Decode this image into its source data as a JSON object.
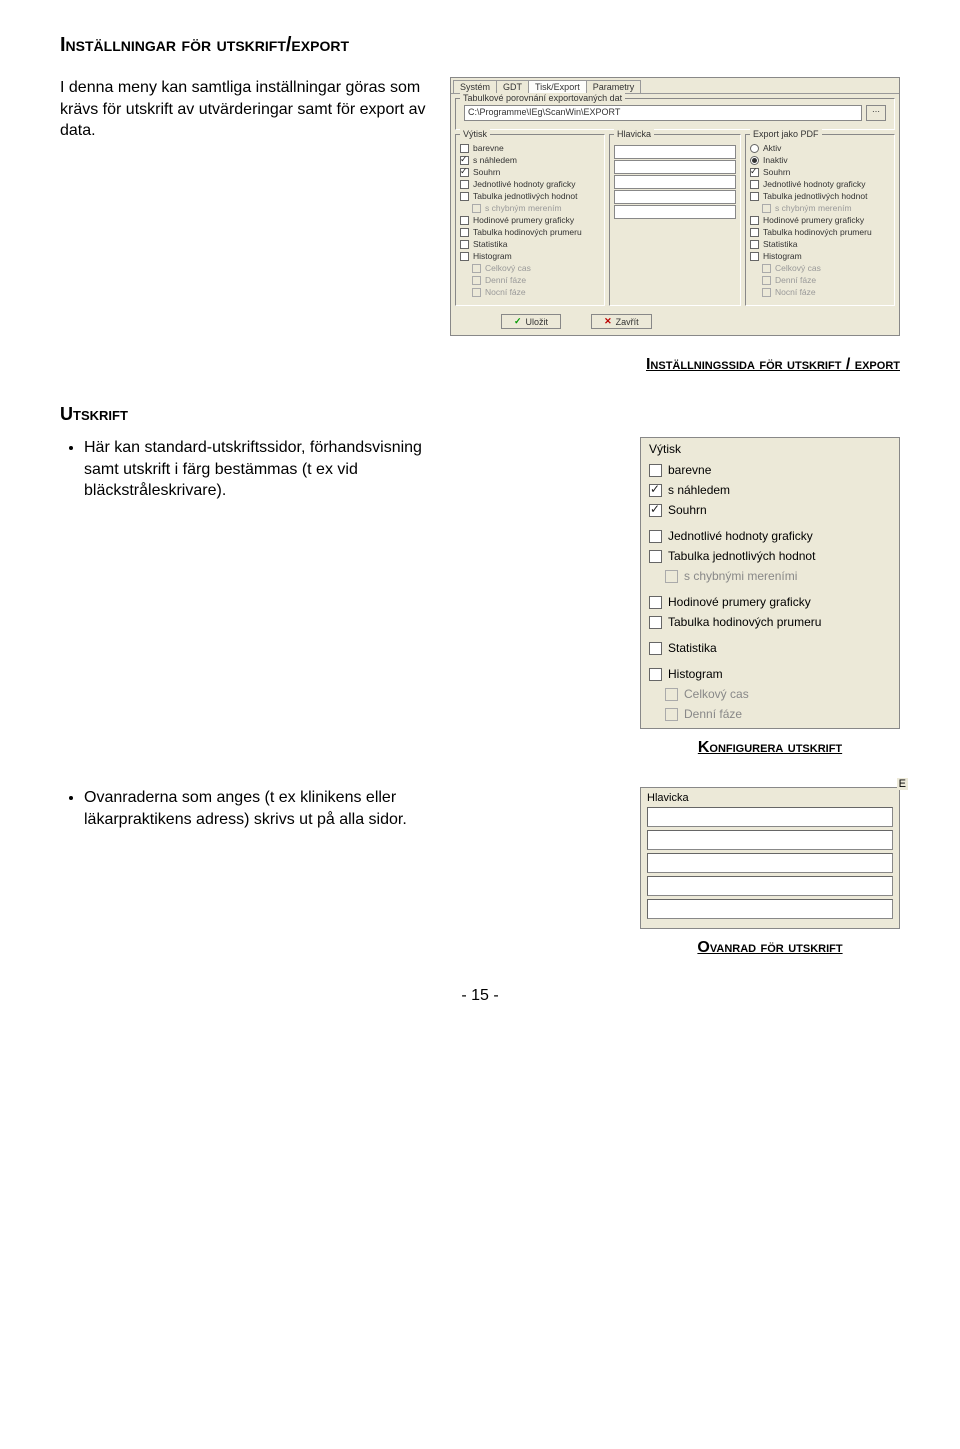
{
  "headings": {
    "main": "Inställningar för utskrift/export",
    "caption1": "Inställningssida för utskrift / export",
    "sub_utskrift": "Utskrift",
    "caption2": "Konfigurera utskrift",
    "caption3": "Ovanrad för utskrift"
  },
  "intro": "I denna meny kan samtliga inställningar göras som krävs för utskrift av utvärderingar samt för export av data.",
  "bullet1": "Här kan standard-utskriftssidor, förhandsvisning samt utskrift i färg bestämmas (t ex vid bläckstråleskrivare).",
  "bullet2": "Ovanraderna som anges (t ex klinikens eller läkarpraktikens adress) skrivs ut på alla sidor.",
  "settings_window": {
    "tabs": [
      "Systém",
      "GDT",
      "Tisk/Export",
      "Parametry"
    ],
    "group_label": "Tabulkové porovnání exportovaných dat",
    "path": "C:\\Programme\\IEg\\ScanWin\\EXPORT",
    "col_vytisk": {
      "title": "Výtisk",
      "items": [
        {
          "label": "barevne",
          "checked": false
        },
        {
          "label": "s náhledem",
          "checked": true
        },
        {
          "label": "Souhrn",
          "checked": true
        },
        {
          "label": "Jednotlivé hodnoty graficky",
          "checked": false
        },
        {
          "label": "Tabulka jednotlivých hodnot",
          "checked": false
        },
        {
          "label": "s chybným merením",
          "checked": false,
          "indent": true,
          "disabled": true
        },
        {
          "label": "Hodinové prumery graficky",
          "checked": false
        },
        {
          "label": "Tabulka hodinových prumeru",
          "checked": false
        },
        {
          "label": "Statistika",
          "checked": false
        },
        {
          "label": "Histogram",
          "checked": false
        },
        {
          "label": "Celkový cas",
          "checked": false,
          "indent": true,
          "disabled": true
        },
        {
          "label": "Denní fáze",
          "checked": false,
          "indent": true,
          "disabled": true
        },
        {
          "label": "Nocní fáze",
          "checked": false,
          "indent": true,
          "disabled": true
        }
      ]
    },
    "col_hlavicka": {
      "title": "Hlavicka"
    },
    "col_export": {
      "title": "Export jako PDF",
      "radios": [
        {
          "label": "Aktiv",
          "checked": false
        },
        {
          "label": "Inaktiv",
          "checked": true
        }
      ],
      "items": [
        {
          "label": "Souhrn",
          "checked": true
        },
        {
          "label": "Jednotlivé hodnoty graficky",
          "checked": false
        },
        {
          "label": "Tabulka jednotlivých hodnot",
          "checked": false
        },
        {
          "label": "s chybným merením",
          "checked": false,
          "indent": true,
          "disabled": true
        },
        {
          "label": "Hodinové prumery graficky",
          "checked": false
        },
        {
          "label": "Tabulka hodinových prumeru",
          "checked": false
        },
        {
          "label": "Statistika",
          "checked": false
        },
        {
          "label": "Histogram",
          "checked": false
        },
        {
          "label": "Celkový cas",
          "checked": false,
          "indent": true,
          "disabled": true
        },
        {
          "label": "Denní fáze",
          "checked": false,
          "indent": true,
          "disabled": true
        },
        {
          "label": "Nocní fáze",
          "checked": false,
          "indent": true,
          "disabled": true
        }
      ]
    },
    "buttons": {
      "save": "Uložit",
      "cancel": "Zavřít"
    }
  },
  "panel_vytisk2": {
    "title": "Výtisk",
    "items": [
      {
        "label": "barevne",
        "checked": false
      },
      {
        "label": "s náhledem",
        "checked": true
      },
      {
        "label": "Souhrn",
        "checked": true
      },
      {
        "gap": true
      },
      {
        "label": "Jednotlivé hodnoty graficky",
        "checked": false
      },
      {
        "label": "Tabulka jednotlivých hodnot",
        "checked": false
      },
      {
        "label": "s chybnými mereními",
        "checked": false,
        "indent": true,
        "disabled": true
      },
      {
        "gap": true
      },
      {
        "label": "Hodinové prumery graficky",
        "checked": false
      },
      {
        "label": "Tabulka hodinových prumeru",
        "checked": false
      },
      {
        "gap": true
      },
      {
        "label": "Statistika",
        "checked": false
      },
      {
        "gap": true
      },
      {
        "label": "Histogram",
        "checked": false
      },
      {
        "label": "Celkový cas",
        "checked": false,
        "indent": true,
        "disabled": true
      },
      {
        "label": "Denní fáze",
        "checked": false,
        "indent": true,
        "disabled": true
      }
    ]
  },
  "panel_hlavicka2": {
    "corner": "E",
    "title": "Hlavicka"
  },
  "pagenum": "- 15 -"
}
